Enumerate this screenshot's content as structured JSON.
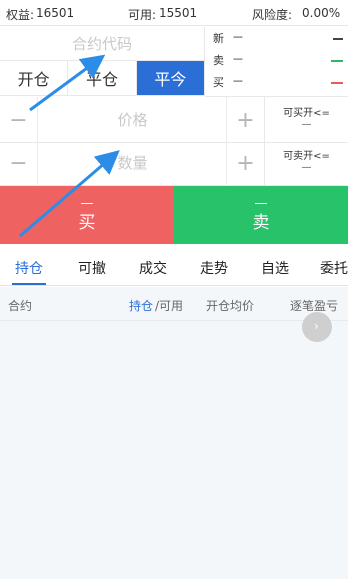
{
  "account": {
    "equity_label": "权益:",
    "equity_value": "16501",
    "available_label": "可用:",
    "available_value": "15501",
    "risk_label": "风险度:",
    "risk_value": "0.00%"
  },
  "order": {
    "code_placeholder": "合约代码",
    "modes": [
      "开仓",
      "平仓",
      "平今"
    ],
    "active_mode_index": 2,
    "price_placeholder": "价格",
    "qty_placeholder": "数量",
    "minus_symbol": "−",
    "plus_symbol": "+"
  },
  "quote": {
    "last_label": "新",
    "ask_label": "卖",
    "bid_label": "买",
    "dash": "---",
    "colors": {
      "last": "#444444",
      "ask": "#2bb86a",
      "bid": "#e55a5a"
    }
  },
  "availability": {
    "buy_label": "可买开<=",
    "buy_value": "—",
    "sell_label": "可卖开<=",
    "sell_value": "—"
  },
  "trade": {
    "buy_price": "—",
    "buy_label": "买",
    "sell_price": "—",
    "sell_label": "卖",
    "colors": {
      "buy": "#ee6262",
      "sell": "#27c26a",
      "accent": "#2b6fd6"
    }
  },
  "tabs": [
    "持仓",
    "可撤",
    "成交",
    "走势",
    "自选",
    "委托"
  ],
  "active_tab_index": 0,
  "table": {
    "contract_col": "合约",
    "position_col": "持仓",
    "available_col": "/可用",
    "avg_price_col": "开仓均价",
    "pnl_col": "逐笔盈亏"
  },
  "scroll_button_glyph": "›"
}
